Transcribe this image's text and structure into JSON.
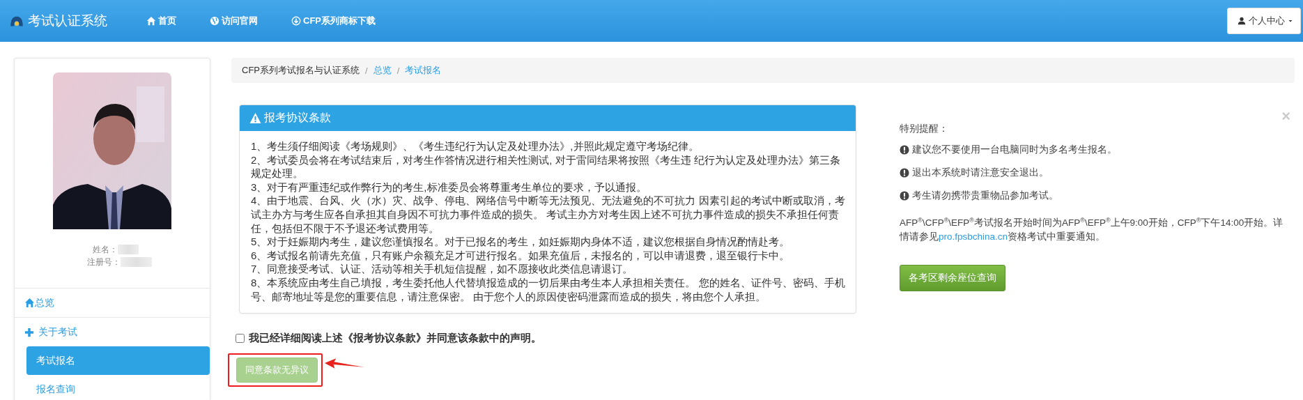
{
  "navbar": {
    "brand": "考试认证系统",
    "items": [
      {
        "kind": "home",
        "label": "首页"
      },
      {
        "kind": "globe",
        "label": "访问官网"
      },
      {
        "kind": "download",
        "label": "CFP系列商标下载"
      }
    ],
    "user_menu": {
      "label": "个人中心"
    }
  },
  "sidebar": {
    "profile": {
      "fields": [
        {
          "label": "姓名："
        },
        {
          "label": "注册号："
        }
      ]
    },
    "menu": [
      {
        "kind": "overview",
        "label": "总览"
      },
      {
        "kind": "group",
        "label": "关于考试",
        "children": [
          {
            "label": "考试报名",
            "selected": true
          },
          {
            "label": "报名查询",
            "selected": false
          }
        ]
      }
    ]
  },
  "breadcrumb": [
    {
      "kind": "text",
      "label": "CFP系列考试报名与认证系统"
    },
    {
      "kind": "link",
      "separator": "/",
      "label": "总览"
    },
    {
      "kind": "link",
      "separator": "/",
      "label": "考试报名"
    }
  ],
  "agreement": {
    "title": "报考协议条款",
    "paragraphs": [
      "1、考生须仔细阅读《考场规则》、《考生违纪行为认定及处理办法》,并照此规定遵守考场纪律。",
      "2、考试委员会将在考试结束后，对考生作答情况进行相关性测试, 对于雷同结果将按照《考生违 纪行为认定及处理办法》第三条规定处理。",
      "3、对于有严重违纪或作弊行为的考生,标准委员会将尊重考生单位的要求，予以通报。",
      "4、由于地震、台风、火（水）灾、战争、停电、网络信号中断等无法预见、无法避免的不可抗力 因素引起的考试中断或取消，考试主办方与考生应各自承担其自身因不可抗力事件造成的损失。 考试主办方对考生因上述不可抗力事件造成的损失不承担任何责任，包括但不限于不予退还考试费用等。",
      "5、对于妊娠期内考生，建议您谨慎报名。对于已报名的考生，如妊娠期内身体不适，建议您根据自身情况酌情赴考。",
      "6、考试报名前请先充值，只有账户余额充足才可进行报名。如果充值后，未报名的，可以申请退费，退至银行卡中。",
      "7、同意接受考试、认证、活动等相关手机短信提醒，如不愿接收此类信息请退订。",
      "8、本系统应由考生自己填报，考生委托他人代替填报造成的一切后果由考生本人承担相关责任。 您的姓名、证件号、密码、手机号、邮寄地址等是您的重要信息，请注意保密。 由于您个人的原因使密码泄露而造成的损失，将由您个人承担。"
    ],
    "consent": {
      "label": "我已经详细阅读上述《报考协议条款》并同意该条款中的声明。",
      "checked": false
    },
    "agree_button": {
      "label": "同意条款无异议",
      "disabled": true,
      "highlighted": true
    }
  },
  "notice": {
    "close": "×",
    "title": "特别提醒：",
    "warnings": [
      "建议您不要使用一台电脑同时为多名考生报名。",
      "退出本系统时请注意安全退出。",
      "考生请勿携带贵重物品参加考试。"
    ],
    "info": {
      "text_before": "AFP$^{®}$\\CFP$^{®}$\\EFP$^{®}$考试报名开始时间为AFP$^{®}$\\EFP$^{®}$上午9:00开始，CFP$^{®}$下午14:00开始。详情请参见",
      "link": "pro.fpsbchina.cn",
      "text_after": "资格考试中重要通知。"
    },
    "seat_button": "各考区剩余座位查询"
  }
}
